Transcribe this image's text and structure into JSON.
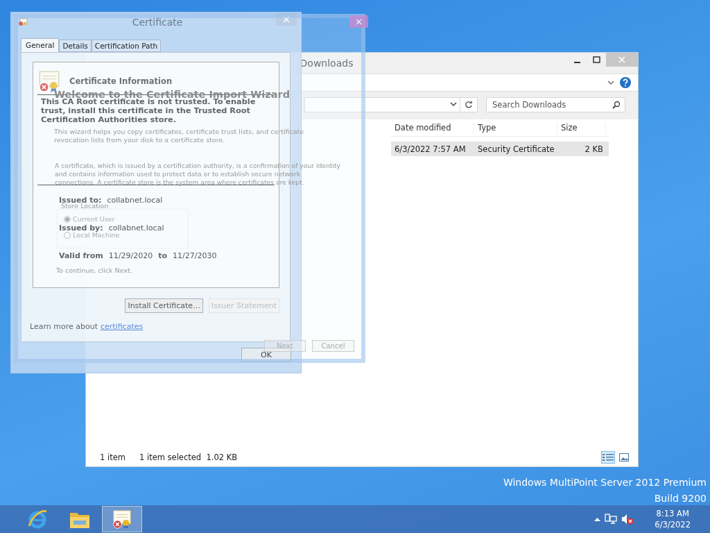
{
  "desktop": {
    "edition": "Windows MultiPoint Server 2012 Premium",
    "build": "Build 9200"
  },
  "explorer": {
    "title": "Downloads",
    "search": {
      "placeholder": "Search Downloads"
    },
    "columns": [
      "Date modified",
      "Type",
      "Size"
    ],
    "rows": [
      {
        "date_modified": "6/3/2022 7:57 AM",
        "type": "Security Certificate",
        "size": "2 KB",
        "selected": true
      }
    ],
    "status": {
      "count": "1 item",
      "selection": "1 item selected  1.02 KB"
    },
    "views": [
      {
        "kind": "details",
        "selected": true
      },
      {
        "kind": "thumbnails",
        "selected": false
      }
    ]
  },
  "wizard": {
    "heading": "Welcome to the Certificate Import Wizard",
    "intro": "This wizard helps you copy certificates, certificate trust lists, and certificate revocation lists from your disk to a certificate store.",
    "explanation": "A certificate, which is issued by a certification authority, is a confirmation of your identity and contains information used to protect data or to establish secure network connections. A certificate store is the system area where certificates are kept.",
    "store_location": {
      "label": "Store Location",
      "options": [
        {
          "label": "Current User",
          "selected": true
        },
        {
          "label": "Local Machine",
          "selected": false
        }
      ]
    },
    "hint": "To continue, click Next.",
    "buttons": [
      "Next",
      "Cancel"
    ]
  },
  "certificate": {
    "title": "Certificate",
    "tabs": [
      {
        "label": "General",
        "selected": true
      },
      {
        "label": "Details",
        "selected": false
      },
      {
        "label": "Certification Path",
        "selected": false
      }
    ],
    "heading": "Certificate Information",
    "warning": "This CA Root certificate is not trusted. To enable trust, install this certificate in the Trusted Root Certification Authorities store.",
    "fields": [
      {
        "label": "Issued to:",
        "value": "collabnet.local"
      },
      {
        "label": "Issued by:",
        "value": "collabnet.local"
      }
    ],
    "validity": {
      "label": "Valid from",
      "from": "11/29/2020",
      "separator": "to",
      "to": "11/27/2030"
    },
    "buttons": [
      {
        "label": "Install Certificate...",
        "disabled": false
      },
      {
        "label": "Issuer Statement",
        "disabled": true
      }
    ],
    "learn_more": {
      "text": "Learn more about",
      "link": "certificates"
    },
    "ok": "OK"
  },
  "taskbar": {
    "apps": [
      {
        "kind": "browser",
        "selected": false
      },
      {
        "kind": "folder",
        "selected": false
      },
      {
        "kind": "certificate",
        "selected": true
      }
    ],
    "time": "8:13 AM",
    "date": "6/3/2022"
  }
}
